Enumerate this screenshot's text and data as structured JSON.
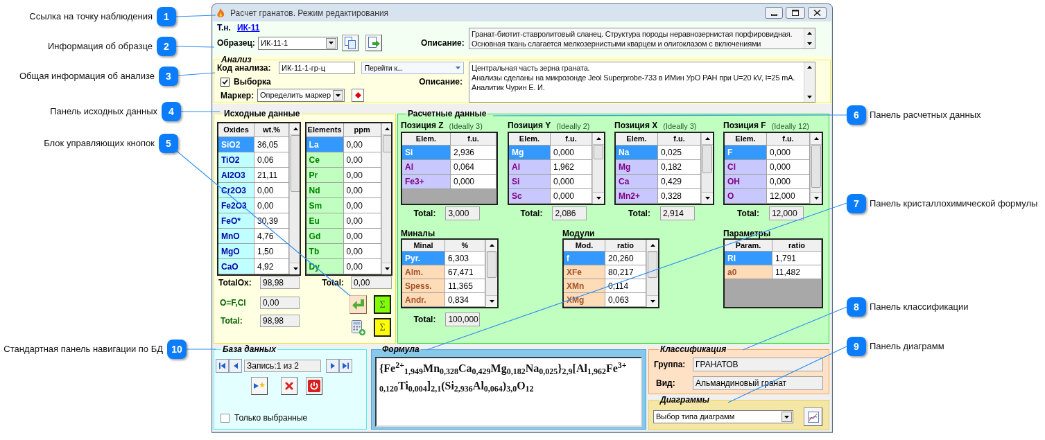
{
  "callouts": [
    {
      "number": "1",
      "label": "Ссылка на точку наблюдения"
    },
    {
      "number": "2",
      "label": "Информация об образце"
    },
    {
      "number": "3",
      "label": "Общая информация об анализе"
    },
    {
      "number": "4",
      "label": "Панель исходных данных"
    },
    {
      "number": "6",
      "label": "Панель расчетных данных"
    },
    {
      "number": "5",
      "label": "Блок управляющих кнопок"
    },
    {
      "number": "7",
      "label": "Панель кристаллохимической формулы"
    },
    {
      "number": "8",
      "label": "Панель классификации"
    },
    {
      "number": "10",
      "label": "Стандартная панель навигации по БД"
    },
    {
      "number": "9",
      "label": "Панель диаграмм"
    }
  ],
  "window": {
    "title": "Расчет гранатов. Режим редактирования"
  },
  "sample": {
    "point_label": "Т.н.",
    "point_link": "ИК-11",
    "sample_label": "Образец:",
    "sample_value": "ИК-11-1",
    "description_label": "Описание:",
    "description_lines": [
      "Гранат-биотит-ставролитовый сланец. Структура породы неравнозернистая порфировидная.",
      "Основная ткань слагается мелкозернистыми кварцем и олигоклазом с включениями"
    ]
  },
  "analysis": {
    "legend": "Анализ",
    "code_label": "Код анализа:",
    "code_value": "ИК-11-1-гр-ц",
    "goto": "Перейти к...",
    "selection": {
      "label": "Выборка",
      "checked": true
    },
    "marker_label": "Маркер:",
    "marker_value": "Определить маркер",
    "description_label": "Описание:",
    "description_lines": [
      "Центральная часть зерна граната.",
      "Анализы сделаны на микрозонде Jeol Superprobe-733 в ИМин УрО РАН при U=20 kV, I=25 mA.",
      "Аналитик Чурин Е. И."
    ]
  },
  "source_data": {
    "legend": "Исходные данные",
    "oxides": {
      "columns": [
        "Oxides",
        "wt.%"
      ],
      "rows": [
        {
          "name": "SiO2",
          "value": "36,05",
          "selected": true
        },
        {
          "name": "TiO2",
          "value": "0,06",
          "selected": false
        },
        {
          "name": "Al2O3",
          "value": "21,11",
          "selected": false
        },
        {
          "name": "Cr2O3",
          "value": "0,00",
          "selected": false
        },
        {
          "name": "Fe2O3",
          "value": "0,00",
          "selected": false
        },
        {
          "name": "FeO*",
          "value": "30,39",
          "selected": false
        },
        {
          "name": "MnO",
          "value": "4,76",
          "selected": false
        },
        {
          "name": "MgO",
          "value": "1,50",
          "selected": false
        },
        {
          "name": "CaO",
          "value": "4,92",
          "selected": false
        }
      ]
    },
    "elements": {
      "columns": [
        "Elements",
        "ppm"
      ],
      "rows": [
        {
          "name": "La",
          "value": "0,00",
          "selected": true
        },
        {
          "name": "Ce",
          "value": "0,00",
          "selected": false
        },
        {
          "name": "Pr",
          "value": "0,00",
          "selected": false
        },
        {
          "name": "Nd",
          "value": "0,00",
          "selected": false
        },
        {
          "name": "Sm",
          "value": "0,00",
          "selected": false
        },
        {
          "name": "Eu",
          "value": "0,00",
          "selected": false
        },
        {
          "name": "Gd",
          "value": "0,00",
          "selected": false
        },
        {
          "name": "Tb",
          "value": "0,00",
          "selected": false
        },
        {
          "name": "Dy",
          "value": "0,00",
          "selected": false
        }
      ]
    },
    "oxide_total": {
      "label": "TotalOx:",
      "value": "98,98"
    },
    "element_total": {
      "label": "Total:",
      "value": "0,00"
    },
    "correction": {
      "label": "O=F,Cl",
      "value": "0,00"
    },
    "total": {
      "label": "Total:",
      "value": "98,98"
    },
    "buttons": [
      {
        "kind": "enter"
      },
      {
        "kind": "sum",
        "label": "Σ",
        "color": "#80ff00"
      },
      {
        "kind": "calculator"
      },
      {
        "kind": "sum",
        "label": "Σ",
        "color": "#ffff00"
      }
    ]
  },
  "calculated": {
    "legend": "Расчетные данные",
    "positions": [
      {
        "title": "Позиция Z",
        "ideal": "(Ideally 3)",
        "columns": [
          "Elem.",
          "f.u."
        ],
        "scrollable": false,
        "rows": [
          {
            "name": "Si",
            "value": "2,936",
            "selected": true
          },
          {
            "name": "Al",
            "value": "0,064",
            "selected": false
          },
          {
            "name": "Fe3+",
            "value": "0,000",
            "selected": false
          }
        ],
        "total_label": "Total:",
        "total": "3,000"
      },
      {
        "title": "Позиция Y",
        "ideal": "(Ideally 2)",
        "columns": [
          "Elem.",
          "f.u."
        ],
        "scrollable": true,
        "rows": [
          {
            "name": "Mg",
            "value": "0,000",
            "selected": true
          },
          {
            "name": "Al",
            "value": "1,962",
            "selected": false
          },
          {
            "name": "Si",
            "value": "0,000",
            "selected": false
          },
          {
            "name": "Sc",
            "value": "0,000",
            "selected": false
          }
        ],
        "total_label": "Total:",
        "total": "2,086"
      },
      {
        "title": "Позиция X",
        "ideal": "(Ideally 3)",
        "columns": [
          "Elem.",
          "f.u."
        ],
        "scrollable": true,
        "rows": [
          {
            "name": "Na",
            "value": "0,025",
            "selected": true
          },
          {
            "name": "Mg",
            "value": "0,182",
            "selected": false
          },
          {
            "name": "Ca",
            "value": "0,429",
            "selected": false
          },
          {
            "name": "Mn2+",
            "value": "0,328",
            "selected": false
          }
        ],
        "total_label": "Total:",
        "total": "2,914"
      },
      {
        "title": "Позиция F",
        "ideal": "(Ideally 12)",
        "columns": [
          "Elem.",
          "f.u."
        ],
        "scrollable": true,
        "rows": [
          {
            "name": "F",
            "value": "0,000",
            "selected": true
          },
          {
            "name": "Cl",
            "value": "0,000",
            "selected": false
          },
          {
            "name": "OH",
            "value": "0,000",
            "selected": false
          },
          {
            "name": "O",
            "value": "12,000",
            "selected": false
          }
        ],
        "total_label": "Total:",
        "total": "12,000"
      }
    ],
    "minals": {
      "title": "Миналы",
      "columns": [
        "Minal",
        "%"
      ],
      "scrollable": true,
      "rows": [
        {
          "name": "Pyr.",
          "value": "6,303",
          "selected": true
        },
        {
          "name": "Alm.",
          "value": "67,471",
          "selected": false
        },
        {
          "name": "Spess.",
          "value": "11,365",
          "selected": false
        },
        {
          "name": "Andr.",
          "value": "0,834",
          "selected": false
        }
      ],
      "total_label": "Total:",
      "total": "100,000"
    },
    "modules": {
      "title": "Модули",
      "columns": [
        "Mod.",
        "ratio"
      ],
      "scrollable": true,
      "rows": [
        {
          "name": "f",
          "value": "20,260",
          "selected": true
        },
        {
          "name": "XFe",
          "value": "80,217",
          "selected": false
        },
        {
          "name": "XMn",
          "value": "0,114",
          "selected": false
        },
        {
          "name": "XMg",
          "value": "0,063",
          "selected": false
        }
      ]
    },
    "parameters": {
      "title": "Параметры",
      "columns": [
        "Param.",
        "ratio"
      ],
      "scrollable": false,
      "rows": [
        {
          "name": "RI",
          "value": "1,791",
          "selected": true
        },
        {
          "name": "a0",
          "value": "11,482",
          "selected": false
        }
      ]
    }
  },
  "database": {
    "legend": "База данных",
    "record": "Запись:1 из 2",
    "only_selected": {
      "label": "Только выбранные",
      "checked": false
    }
  },
  "formula": {
    "legend": "Формула",
    "text": "{Fe$^{2+}$$_{1,949}$Mn$_{0,328}$Ca$_{0,429}$Mg$_{0,182}$Na$_{0,025}$}$_{2,9}$[Al$_{1,962}$Fe$^{3+}$$_{0,120}$Ti$_{0,004}$]$_{2,1}$(Si$_{2,936}$Al$_{0,064}$)$_{3,0}$O$_{12}$"
  },
  "classification": {
    "legend": "Классификация",
    "group_label": "Группа:",
    "group": "ГРАНАТОВ",
    "type_label": "Вид:",
    "type": "Альмандиновый гранат"
  },
  "diagrams": {
    "legend": "Диаграммы",
    "value": "Выбор типа диаграмм"
  }
}
